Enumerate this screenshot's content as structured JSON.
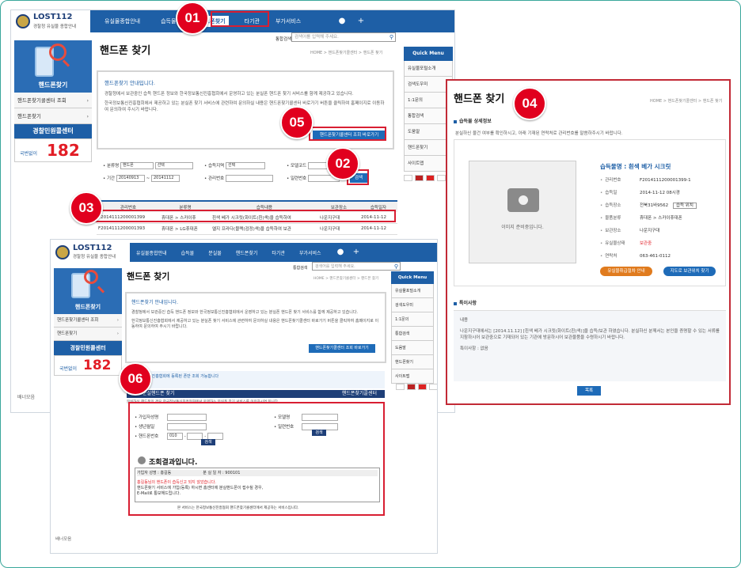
{
  "nav": {
    "items": [
      "유실물종합안내",
      "습득물",
      "분실물",
      "핸드폰찾기",
      "타기관",
      "부가서비스"
    ],
    "short_items": [
      "유실물종합안내",
      "습득물",
      "핸드폰찾기",
      "타기관",
      "부가서비스"
    ]
  },
  "logo": {
    "title": "LOST112",
    "subtitle": "경찰청 유실물 종합안내"
  },
  "search": {
    "label": "통합검색",
    "placeholder": "검색어를 입력해 주세요."
  },
  "sidebar": {
    "title": "핸드폰찾기",
    "items": [
      "핸드폰찾기콜센터 조회",
      "핸드폰찾기"
    ],
    "police": "경찰민원콜센터",
    "phone_label": "국번없이",
    "phone": "182",
    "banner": "배너모음"
  },
  "page": {
    "title": "핸드폰 찾기",
    "crumb": "HOME > 핸드폰찾기콜센터 > 핸드폰 찾기"
  },
  "info": {
    "heading": "핸드폰찾기 안내입니다.",
    "p1": "경찰청에서 보관중인 습득 핸드폰 정보와 한국정보통신진흥협회에서 운영하고 있는 분실폰 핸드폰 찾기 서비스를 함께 제공하고 있습니다.",
    "p2": "한국정보통신진흥협회에서 제공하고 있는 분실폰 찾기 서비스에 관련하여 문의하실 내용은 핸드폰찾기콜센터 바로가기 버튼을 클릭하여 홈페이지로 이동하여 문의하여 주시기 바랍니다.",
    "button": "핸드폰찾기콜센터 조회 바로가기"
  },
  "quick": {
    "title": "Quick Menu",
    "items": [
      "유실물포털소개",
      "검색도우미",
      "1:1문의",
      "통합검색",
      "도움말",
      "핸드폰찾기",
      "사이트맵"
    ]
  },
  "form": {
    "cat_label": "분류명",
    "cat_value": "핸드폰",
    "cat2_value": "선택",
    "region_label": "습득지역",
    "region_value": "선택",
    "model_label": "모델코드",
    "period_label": "기간",
    "date_from": "20140913",
    "date_to": "20141112",
    "manage_label": "관리번호",
    "serial_label": "일련번호",
    "search_btn": "검색"
  },
  "table": {
    "headers": [
      "관리번호",
      "분류명",
      "습득내용",
      "보관장소",
      "습득일자"
    ],
    "rows": [
      [
        "F2014111200001399",
        "휴대폰 > 스카이휴",
        "흰색 베가 시크릿(화이트(흰)색)을 습득하여",
        "나운지구대",
        "2014-11-12"
      ],
      [
        "F2014111200001393",
        "휴대폰 > LG휴대폰",
        "엘지 프라다(블랙(검정)색)을 습득하여 보관",
        "나운지구대",
        "2014-11-12"
      ]
    ]
  },
  "detail": {
    "title": "핸드폰 찾기",
    "crumb": "HOME > 핸드폰찾기콜센터 > 핸드폰 찾기",
    "section": "습득물 상세정보",
    "desc": "분실하신 물건 여부를 확인하시고, 아래 기재된 연락처로 관리번호를 말씀하주시기 바랍니다.",
    "item_title": "습득물명 : 흰색 베가 시크릿",
    "no_image": "이미지 준비중입니다.",
    "rows": [
      [
        "관리번호",
        "F2014111200001399-1"
      ],
      [
        "습득일",
        "2014-11-12 08시경"
      ],
      [
        "습득장소",
        "전북31바9562"
      ],
      [
        "물품분류",
        "휴대폰 > 스카이휴대폰"
      ],
      [
        "보관장소",
        "나운지구대"
      ],
      [
        "유실물상태",
        "보관중"
      ],
      [
        "연락처",
        "063-461-0112"
      ]
    ],
    "map_btn": "습득 위치",
    "btn1": "유실물취급절차 안내",
    "btn2": "지도로 보관위치 찾기",
    "notes_title": "특이사항",
    "notes_head": "내용",
    "notes_body": "나운지구대에서는 [2014.11.12] [흰색 베가 시크릿(화이트(흰)색)]을 습득/보관 하였습니다. 분실하신 분께서는 본인을 증명할 수 있는 서류를 지참하시어 보관중으로 기재되어 있는 기관에 방문하시어 보관물품을 수령하시기 바랍니다.",
    "notes_extra": "특이사항 : 없음",
    "list_btn": "목록"
  },
  "callcenter": {
    "banner": "한국정보통신진흥협회에 등록된 폰만 조회 가능합니다",
    "header": "분실핸드폰 찾기",
    "header2": "핸드폰찾기콜센터",
    "lead": "분실하신 핸드폰의 경우 한국정보통신진흥협회에서 운영하는 분실폰 찾기 서비스를 이용하시면 됩니다.",
    "fields": [
      "가입자성명",
      "생년월일",
      "핸드폰번호",
      "모델명",
      "일련번호"
    ],
    "result_title": "조회결과입니다.",
    "result_cols": [
      "가입자 성명 : 홍길동",
      "분 실 일 자 : 900101"
    ],
    "result_text": "홍길동님의 핸드폰이 습득신고 되지 않았습니다.",
    "result_text2": "핸드폰찾기 서비스에 가입(등록) 하시면 홈센터에 분실핸드폰이 접수될 경우,",
    "result_text3": "E-Mail로 통보해드립니다.",
    "footer": "본 서비스는 한국정보통신진흥협회 핸드폰찾기콜센터에서 제공하는 서비스입니다.",
    "phone_prefix": "010"
  },
  "badges": [
    "01",
    "02",
    "03",
    "04",
    "05",
    "06"
  ]
}
